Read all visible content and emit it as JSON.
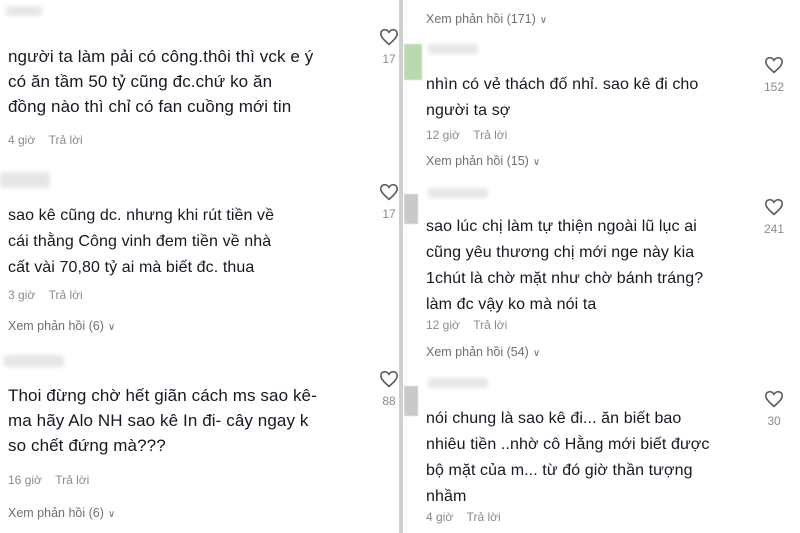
{
  "left": {
    "comments": [
      {
        "text": "người ta làm pải có công.thôi thì vck e ý\ncó ăn tầm 50 tỷ cũng đc.chứ ko ăn\nđồng nào thì chỉ có fan cuồng mới tin",
        "time": "4 giờ",
        "reply": "Trả lời",
        "likes": "17"
      },
      {
        "text": "sao kê cũng dc. nhưng khi rút tiền về\ncái thằng Công vinh đem tiền về nhà\ncất vài 70,80 tỷ ai mà biết đc. thua",
        "time": "3 giờ",
        "reply": "Trả lời",
        "likes": "17",
        "view_replies": "Xem phản hồi (6)"
      },
      {
        "text": "Thoi đừng chờ hết giãn cách ms sao kê-\nma hãy Alo NH sao kê In đi- cây ngay k\nso chết đứng mà???",
        "time": "16 giờ",
        "reply": "Trả lời",
        "likes": "88",
        "view_replies": "Xem phản hồi (6)"
      }
    ]
  },
  "right": {
    "top_view_replies": "Xem phản hồi (171)",
    "comments": [
      {
        "text": "nhìn có vẻ thách đố nhỉ. sao kê đi cho\nngười ta sợ",
        "time": "12 giờ",
        "reply": "Trả lời",
        "likes": "152",
        "view_replies": "Xem phản hồi (15)"
      },
      {
        "text": "sao lúc chị làm tự thiện ngoài lũ lục ai\ncũng yêu thương chị mới nge này kia\n1chút là chờ mặt như chờ bánh tráng?\nlàm đc vậy ko mà nói ta",
        "time": "12 giờ",
        "reply": "Trả lời",
        "likes": "241",
        "view_replies": "Xem phản hồi (54)"
      },
      {
        "text": "nói chung là sao kê đi... ăn biết bao\nnhiêu tiền ..nhờ cô Hằng mới biết được\nbộ mặt của m... từ đó giờ thần tượng\nnhầm",
        "time": "4 giờ",
        "reply": "Trả lời",
        "likes": "30"
      }
    ]
  },
  "colors": {
    "text": "#161823",
    "meta": "#8a8b91",
    "divider": "#cfcfcf"
  },
  "icons": {
    "like": "heart-outline-icon",
    "expand": "chevron-down-icon"
  }
}
